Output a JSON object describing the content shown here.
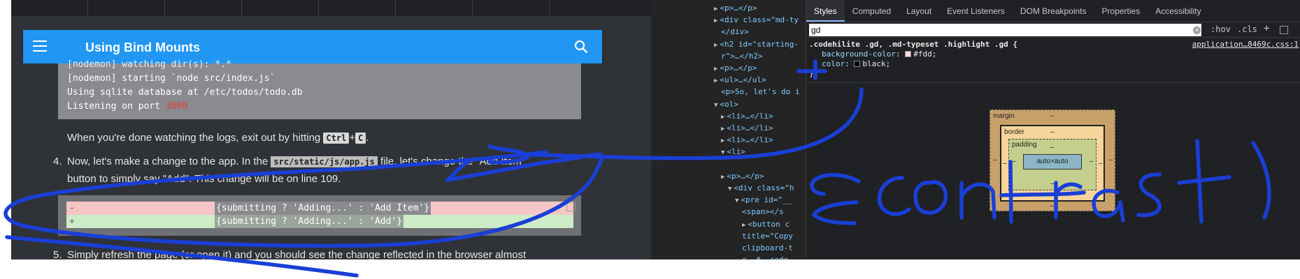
{
  "doc": {
    "header_title": "Using Bind Mounts",
    "code_log": {
      "line0": "[nodemon] watching dir(s): *.*",
      "line1": "[nodemon] starting `node src/index.js`",
      "line2": "Using sqlite database at /etc/todos/todo.db",
      "line3_prefix": "Listening on port ",
      "line3_port": "3000"
    },
    "para_logs": {
      "before": "When you're done watching the logs, exit out by hitting ",
      "key1": "Ctrl",
      "plus": "+",
      "key2": "C",
      "after": "."
    },
    "step4": {
      "number": "4.",
      "text_a": "Now, let's make a change to the app. In the ",
      "file": "src/static/js/app.js",
      "text_b": " file, let's change the \"Add Item\"",
      "line2": "button to simply say \"Add\". This change will be on line 109."
    },
    "diff": {
      "del_sign": "-",
      "del_text": "{submitting ? 'Adding...' : 'Add Item'}",
      "add_sign": "+",
      "add_text": "{submitting ? 'Adding...' : 'Add'}"
    },
    "step5": {
      "number": "5.",
      "text": "Simply refresh the page (or open it) and you should see the change reflected in the browser almost"
    }
  },
  "elements": [
    {
      "tri": "▶",
      "html": "<p>…</p>"
    },
    {
      "tri": "▶",
      "html": "<div class=\"md-ty"
    },
    {
      "tri": "",
      "html": "</div>"
    },
    {
      "tri": "▶",
      "html": "<h2 id=\"starting-"
    },
    {
      "tri": "",
      "html": "r\">…</h2>"
    },
    {
      "tri": "▶",
      "html": "<p>…</p>"
    },
    {
      "tri": "▶",
      "html": "<ul>…</ul>"
    },
    {
      "tri": "",
      "html": "<p>So, let's do i"
    },
    {
      "tri": "▼",
      "html": "<ol>"
    },
    {
      "tri": "▶",
      "html": "<li>…</li>"
    },
    {
      "tri": "▶",
      "html": "<li>…</li>"
    },
    {
      "tri": "▶",
      "html": "<li>…</li>"
    },
    {
      "tri": "▼",
      "html": "<li>"
    },
    {
      "tri": "",
      "html": ""
    },
    {
      "tri": "▶",
      "html": "<p>…</p>"
    },
    {
      "tri": "▼",
      "html": "<div class=\"h"
    },
    {
      "tri": "▼",
      "html": "<pre id=\"__"
    },
    {
      "tri": "",
      "html": "<span></s"
    },
    {
      "tri": "▶",
      "html": "<button c"
    },
    {
      "tri": "",
      "html": "title=\"Copy"
    },
    {
      "tri": "",
      "html": "clipboard-t"
    },
    {
      "tri": "",
      "html": "e, #__code_"
    }
  ],
  "devtools": {
    "tabs": [
      "Styles",
      "Computed",
      "Layout",
      "Event Listeners",
      "DOM Breakpoints",
      "Properties",
      "Accessibility"
    ],
    "active_tab": "Styles",
    "filter_value": "gd",
    "hov": ":hov",
    "cls": ".cls",
    "plus": "+",
    "rule_selector": ".codehilite .gd, .md-typeset .highlight .gd {",
    "rule_source": "application…8469c.css:1",
    "decl1_prop": "background-color",
    "decl1_value": "#fdd;",
    "decl2_prop": "color",
    "decl2_value": "black;",
    "rule_close": "}",
    "colors": {
      "bg_swatch": "#ffdddd",
      "color_swatch": "#000000"
    },
    "box_model": {
      "margin_label": "margin",
      "border_label": "border",
      "padding_label": "padding",
      "content": "auto×auto",
      "dash": "–"
    }
  },
  "annotation": {
    "handwriting": "{contrast}",
    "ink_color": "#1a3fd6"
  }
}
